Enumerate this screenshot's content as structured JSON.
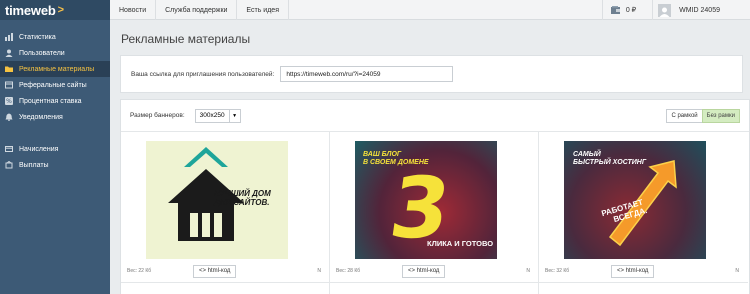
{
  "app": {
    "logo": "timeweb",
    "logo_mark": ">"
  },
  "sidebar": {
    "items": [
      {
        "label": "Статистика",
        "icon": "stats-icon",
        "active": false
      },
      {
        "label": "Пользователи",
        "icon": "users-icon",
        "active": false
      },
      {
        "label": "Рекламные материалы",
        "icon": "folder-icon",
        "active": true
      },
      {
        "label": "Реферальные сайты",
        "icon": "sites-icon",
        "active": false
      },
      {
        "label": "Процентная ставка",
        "icon": "percent-icon",
        "active": false
      },
      {
        "label": "Уведомления",
        "icon": "bell-icon",
        "active": false
      }
    ],
    "items2": [
      {
        "label": "Начисления",
        "icon": "accruals-icon"
      },
      {
        "label": "Выплаты",
        "icon": "payouts-icon"
      }
    ]
  },
  "topbar": {
    "links": [
      "Новости",
      "Служба поддержки",
      "Есть идея"
    ],
    "balance": "0 ₽",
    "user": "WMID 24059"
  },
  "page": {
    "title": "Рекламные материалы",
    "invite_label": "Ваша ссылка для приглашения пользователей:",
    "invite_url": "https://timeweb.com/ru/?i=24059"
  },
  "banners": {
    "size_label": "Размер баннеров:",
    "size_value": "300x250",
    "frame_on": "С рамкой",
    "frame_off": "Без рамки",
    "cards": [
      {
        "weight": "Вес: 22 Кб",
        "button": "<> html-код",
        "badge": "N",
        "text1": "ЛУЧШИЙ ДОМ",
        "text2": "ДЛЯ САЙТОВ."
      },
      {
        "weight": "Вес: 28 Кб",
        "button": "<> html-код",
        "badge": "N",
        "text1": "ВАШ БЛОГ",
        "text2": "В СВОЕМ ДОМЕНЕ",
        "big": "3",
        "text3": "КЛИКА И ГОТОВО"
      },
      {
        "weight": "Вес: 32 Кб",
        "button": "<> html-код",
        "badge": "N",
        "text1": "САМЫЙ",
        "text2": "БЫСТРЫЙ ХОСТИНГ",
        "text3": "РАБОТАЕТ",
        "text4": "ВСЕГДА."
      }
    ]
  },
  "colors": {
    "sidebar": "#3d5a76",
    "active": "#f5c242",
    "accent_green": "#d4ecc1"
  }
}
